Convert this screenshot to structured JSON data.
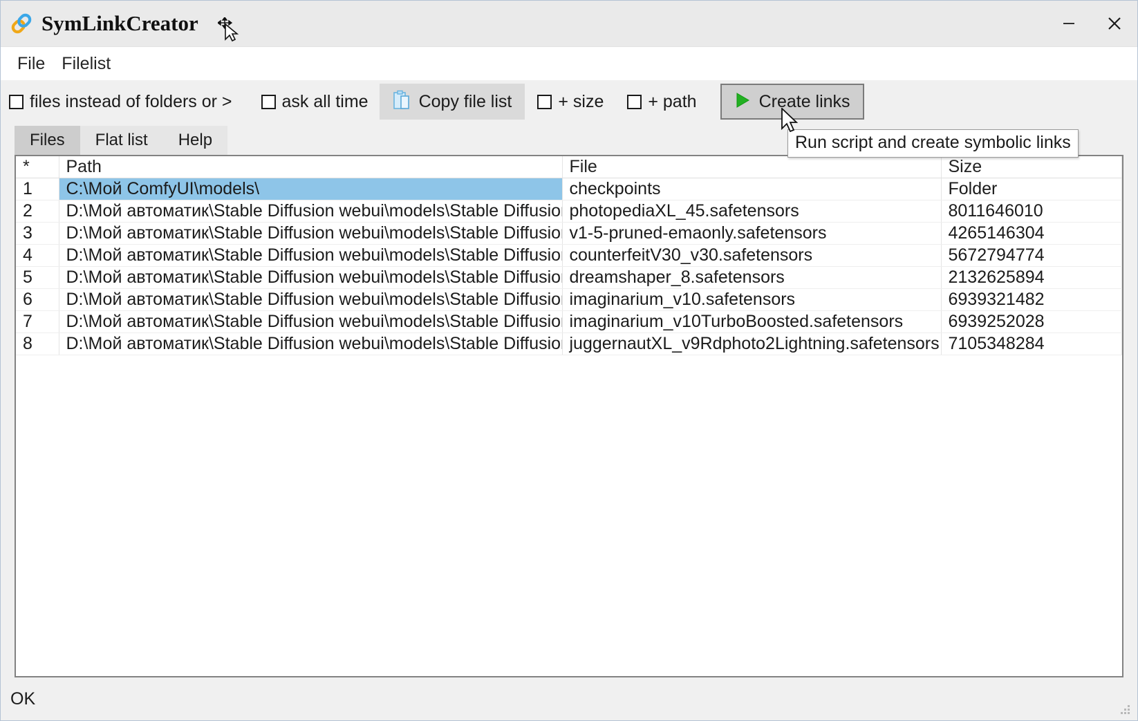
{
  "window": {
    "title": "SymLinkCreator",
    "app_icon": "chain-link-icon",
    "minimize_label": "−",
    "close_label": "✕"
  },
  "menubar": {
    "items": [
      {
        "label": "File"
      },
      {
        "label": "Filelist"
      }
    ]
  },
  "toolbar": {
    "files_instead_label": "files instead of folders or >",
    "ask_all_time_label": "ask all time",
    "copy_file_list_label": "Copy file list",
    "copy_icon": "clipboard-icon",
    "plus_size_label": "+ size",
    "plus_path_label": "+ path",
    "create_links_label": "Create links",
    "create_links_icon": "play-triangle-icon",
    "create_links_accent": "#18a818"
  },
  "tabs": {
    "items": [
      {
        "label": "Files",
        "active": true
      },
      {
        "label": "Flat list",
        "active": false
      },
      {
        "label": "Help",
        "active": false
      }
    ]
  },
  "tooltip": {
    "text": "Run script and create symbolic links"
  },
  "grid": {
    "headers": {
      "num": "*",
      "path": "Path",
      "file": "File",
      "size": "Size"
    },
    "selection_color": "#8ec5e8",
    "rows": [
      {
        "num": "1",
        "path": "C:\\Мой ComfyUI\\models\\",
        "file": "checkpoints",
        "size": "Folder",
        "selected": true
      },
      {
        "num": "2",
        "path": "D:\\Мой автоматик\\Stable Diffusion webui\\models\\Stable Diffusion\\",
        "file": "photopediaXL_45.safetensors",
        "size": "8011646010",
        "selected": false
      },
      {
        "num": "3",
        "path": "D:\\Мой автоматик\\Stable Diffusion webui\\models\\Stable Diffusion\\",
        "file": "v1-5-pruned-emaonly.safetensors",
        "size": "4265146304",
        "selected": false
      },
      {
        "num": "4",
        "path": "D:\\Мой автоматик\\Stable Diffusion webui\\models\\Stable Diffusion\\",
        "file": "counterfeitV30_v30.safetensors",
        "size": "5672794774",
        "selected": false
      },
      {
        "num": "5",
        "path": "D:\\Мой автоматик\\Stable Diffusion webui\\models\\Stable Diffusion\\",
        "file": "dreamshaper_8.safetensors",
        "size": "2132625894",
        "selected": false
      },
      {
        "num": "6",
        "path": "D:\\Мой автоматик\\Stable Diffusion webui\\models\\Stable Diffusion\\",
        "file": "imaginarium_v10.safetensors",
        "size": "6939321482",
        "selected": false
      },
      {
        "num": "7",
        "path": "D:\\Мой автоматик\\Stable Diffusion webui\\models\\Stable Diffusion\\",
        "file": "imaginarium_v10TurboBoosted.safetensors",
        "size": "6939252028",
        "selected": false
      },
      {
        "num": "8",
        "path": "D:\\Мой автоматик\\Stable Diffusion webui\\models\\Stable Diffusion\\",
        "file": "juggernautXL_v9Rdphoto2Lightning.safetensors",
        "size": "7105348284",
        "selected": false
      }
    ]
  },
  "statusbar": {
    "text": "OK"
  }
}
